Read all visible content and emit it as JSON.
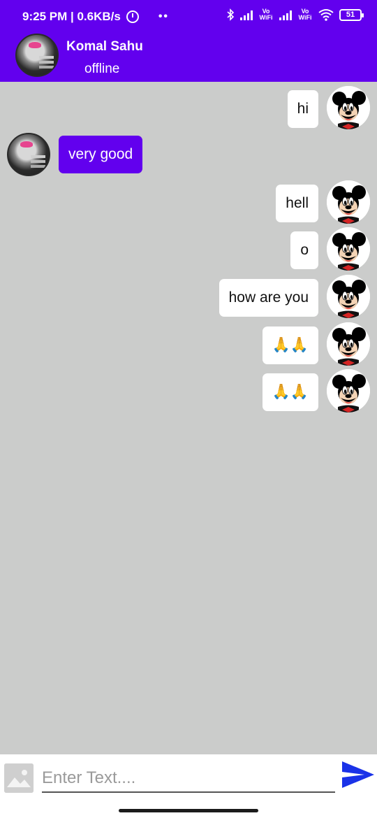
{
  "status_bar": {
    "time_speed": "9:25 PM | 0.6KB/s",
    "dots": "••",
    "vowifi_1": "Vo WiFi",
    "vowifi_2": "Vo WiFi",
    "battery": "51"
  },
  "header": {
    "contact_name": "Komal Sahu",
    "contact_status": "offline"
  },
  "messages": [
    {
      "side": "sent",
      "text": "hi"
    },
    {
      "side": "received",
      "text": "very good"
    },
    {
      "side": "sent",
      "text": "hell"
    },
    {
      "side": "sent",
      "text": "o"
    },
    {
      "side": "sent",
      "text": "how are you"
    },
    {
      "side": "sent",
      "text": "🙏🙏"
    },
    {
      "side": "sent",
      "text": "🙏🙏"
    }
  ],
  "composer": {
    "placeholder": "Enter Text....",
    "image_icon": "image-icon",
    "send_icon": "send-icon"
  },
  "colors": {
    "primary": "#6200ee",
    "chat_background": "#cbcccb",
    "sent_bubble": "#ffffff",
    "received_bubble": "#6200ee",
    "send_icon": "#1a32e8"
  }
}
